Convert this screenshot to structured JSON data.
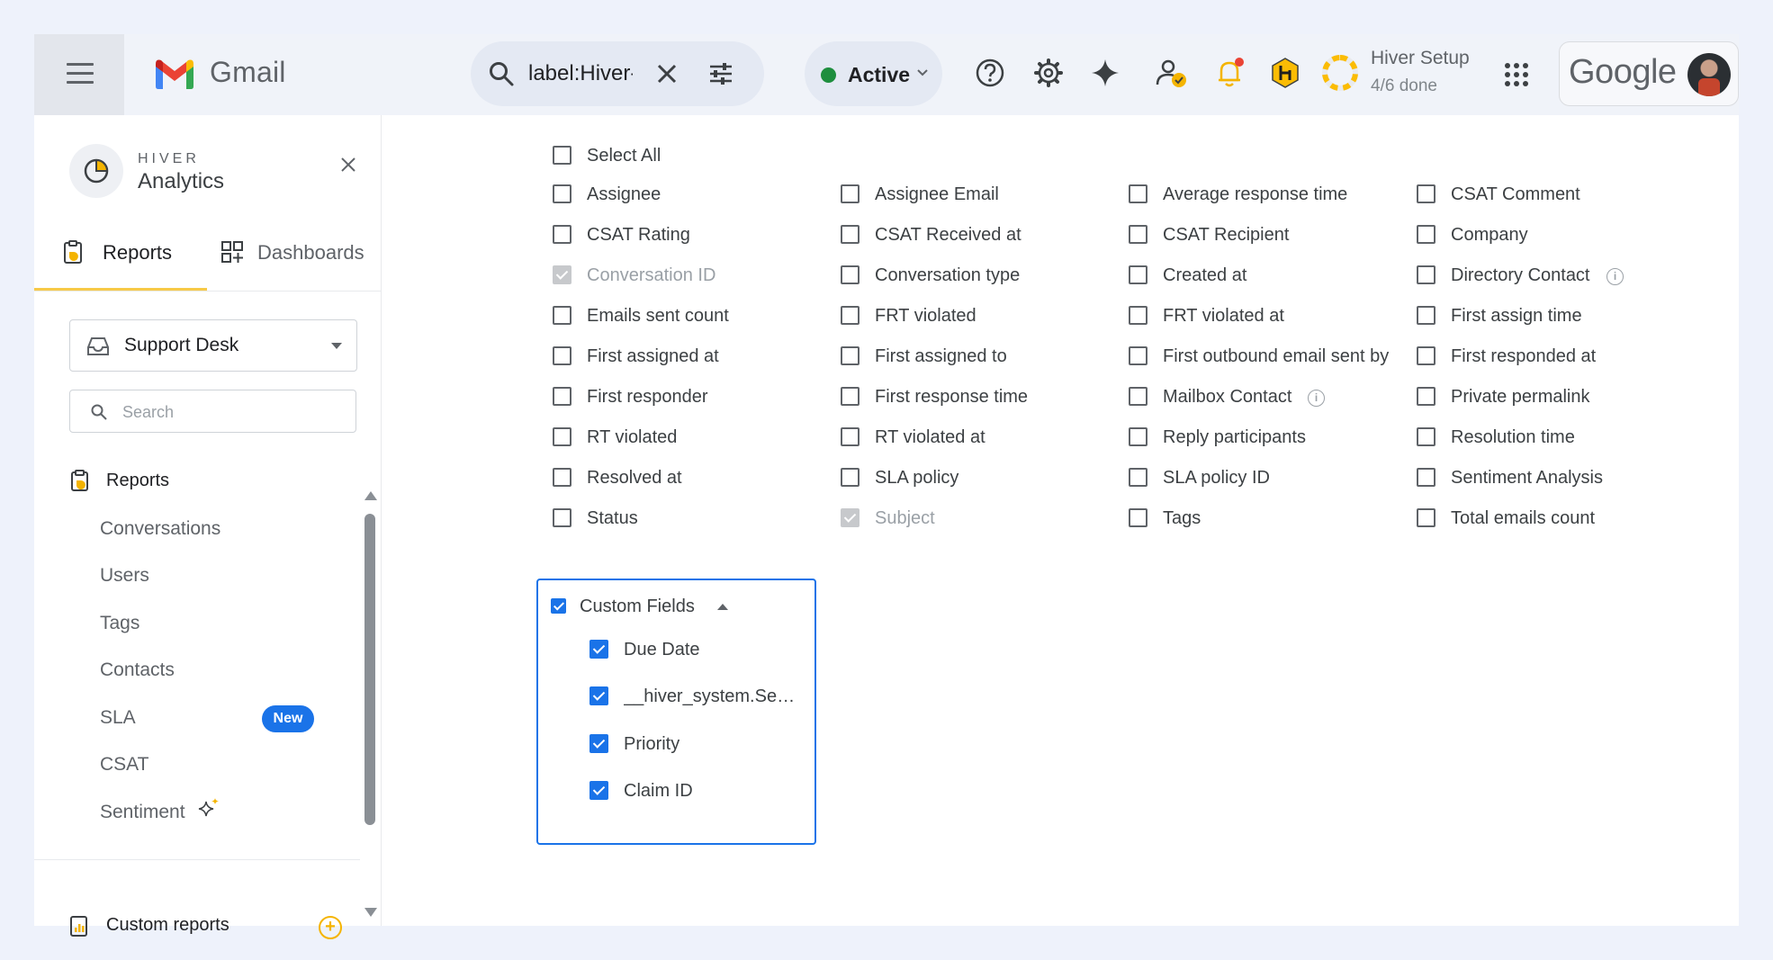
{
  "topbar": {
    "app_name": "Gmail",
    "search_query": "label:Hiver-",
    "status_label": "Active",
    "setup_title": "Hiver Setup",
    "setup_progress": "4/6 done",
    "account_brand": "Google",
    "status_color": "#1e8e3e",
    "icons": [
      "menu-icon",
      "search-icon",
      "clear-icon",
      "tune-icon",
      "help-icon",
      "settings-icon",
      "sparkle-icon",
      "contact-status-icon",
      "bell-icon",
      "hiver-icon",
      "apps-icon"
    ]
  },
  "sidebar": {
    "brand_small": "HIVER",
    "brand_title": "Analytics",
    "tabs": [
      {
        "label": "Reports",
        "active": true
      },
      {
        "label": "Dashboards",
        "active": false
      }
    ],
    "inbox_select": "Support Desk",
    "search_placeholder": "Search",
    "nav_heading": "Reports",
    "nav_items": [
      {
        "label": "Conversations"
      },
      {
        "label": "Users"
      },
      {
        "label": "Tags"
      },
      {
        "label": "Contacts"
      },
      {
        "label": "SLA",
        "badge": "New"
      },
      {
        "label": "CSAT"
      },
      {
        "label": "Sentiment"
      }
    ],
    "custom_reports": "Custom reports",
    "accent_color": "#f7c948"
  },
  "fields": {
    "select_all": "Select All",
    "columns": [
      [
        "Assignee",
        "CSAT Rating",
        "Conversation ID",
        "Emails sent count",
        "First assigned at",
        "First responder",
        "RT violated",
        "Resolved at",
        "Status"
      ],
      [
        "Assignee Email",
        "CSAT Received at",
        "Conversation type",
        "FRT violated",
        "First assigned to",
        "First response time",
        "RT violated at",
        "SLA policy",
        "Subject"
      ],
      [
        "Average response time",
        "CSAT Recipient",
        "Created at",
        "FRT violated at",
        "First outbound email sent by",
        "Mailbox Contact",
        "Reply participants",
        "SLA policy ID",
        "Tags"
      ],
      [
        "CSAT Comment",
        "Company",
        "Directory Contact",
        "First assign time",
        "First responded at",
        "Private permalink",
        "Resolution time",
        "Sentiment Analysis",
        "Total emails count"
      ]
    ],
    "disabled_checked": [
      "Conversation ID",
      "Subject"
    ],
    "info_fields": [
      "Directory Contact",
      "Mailbox Contact"
    ],
    "custom_fields": {
      "label": "Custom Fields",
      "checked": true,
      "expanded": true,
      "items": [
        {
          "label": "Due Date",
          "checked": true
        },
        {
          "label": "__hiver_system.Sentiment",
          "checked": true
        },
        {
          "label": "Priority",
          "checked": true
        },
        {
          "label": "Claim ID",
          "checked": true
        }
      ]
    },
    "checkbox_color": "#1a73e8"
  }
}
